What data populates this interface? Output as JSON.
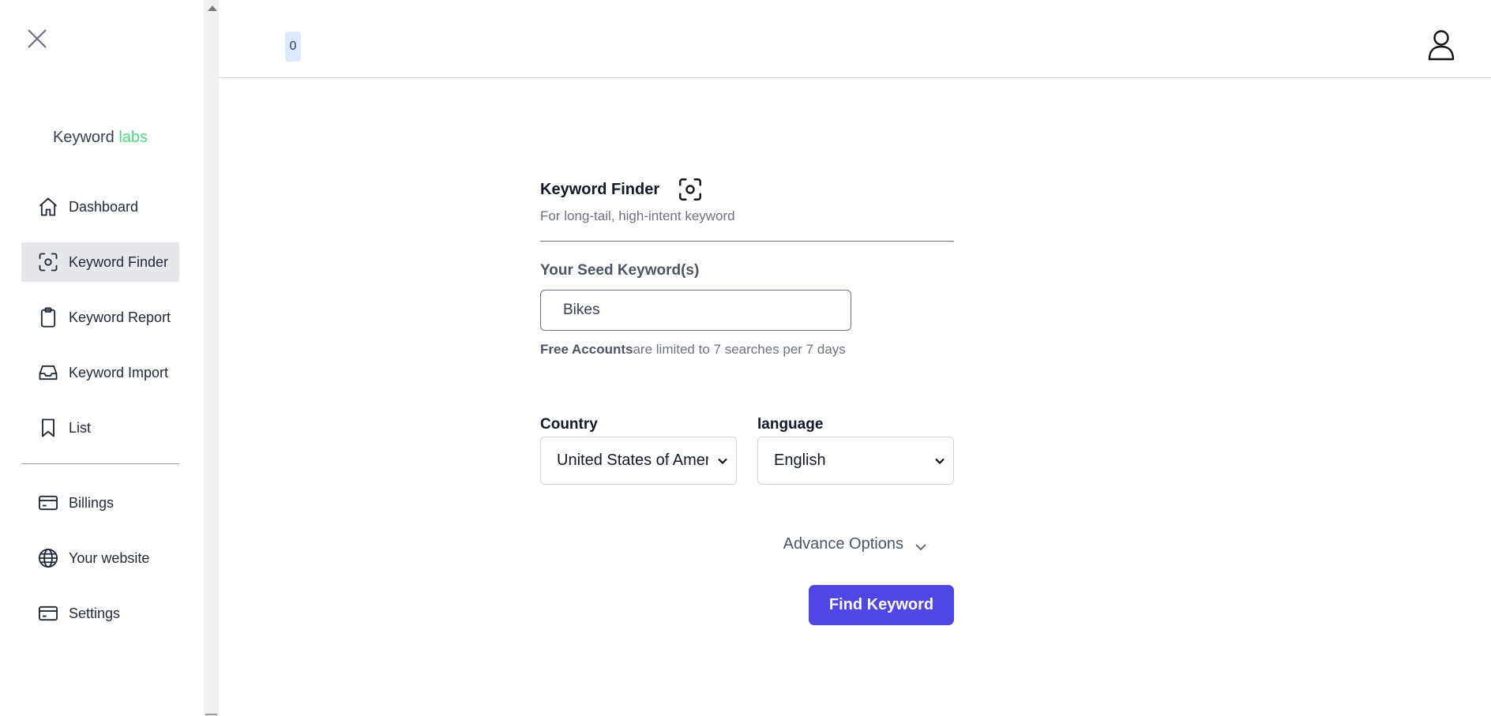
{
  "app": {
    "brand_main": "Keyword ",
    "brand_accent": "labs"
  },
  "sidebar": {
    "items": [
      {
        "label": "Dashboard"
      },
      {
        "label": "Keyword Finder"
      },
      {
        "label": "Keyword Report"
      },
      {
        "label": "Keyword Import"
      },
      {
        "label": "List"
      }
    ],
    "items_secondary": [
      {
        "label": "Billings"
      },
      {
        "label": "Your website"
      },
      {
        "label": "Settings"
      }
    ]
  },
  "header": {
    "counter": "0"
  },
  "finder": {
    "title": "Keyword Finder",
    "subtitle": "For long-tail, high-intent keyword",
    "seed_label": "Your Seed Keyword(s)",
    "seed_value": "Bikes",
    "limit_bold": "Free Accounts",
    "limit_rest": "are limited to 7 searches per 7 days",
    "country_label": "Country",
    "country_value": "United States of America",
    "language_label": "language",
    "language_value": "English",
    "advance_label": "Advance Options",
    "find_button": "Find Keyword"
  },
  "colors": {
    "accent": "#4f46e5",
    "brand_accent": "#4ade80",
    "active_nav": "#e5e7eb"
  }
}
